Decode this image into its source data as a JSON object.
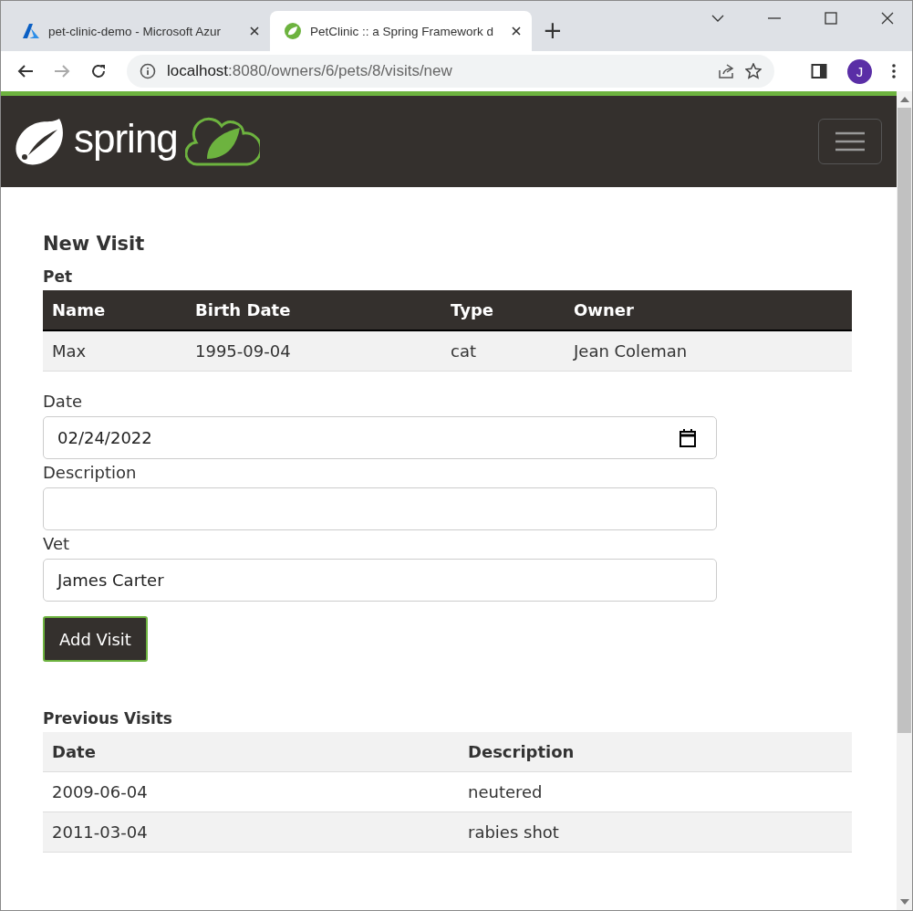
{
  "browser": {
    "tabs": [
      {
        "title": "pet-clinic-demo - Microsoft Azur",
        "selected": false,
        "kind": "azure"
      },
      {
        "title": "PetClinic :: a Spring Framework d",
        "selected": true,
        "kind": "spring"
      }
    ],
    "new_tab": "+",
    "url_host": "localhost",
    "url_path": ":8080/owners/6/pets/8/visits/new",
    "profile": "J"
  },
  "navbar": {
    "logo_text": "spring"
  },
  "page": {
    "title": "New Visit",
    "pet_heading": "Pet",
    "pet_table": {
      "columns": [
        "Name",
        "Birth Date",
        "Type",
        "Owner"
      ],
      "rows": [
        [
          "Max",
          "1995-09-04",
          "cat",
          "Jean Coleman"
        ]
      ]
    },
    "form": {
      "date_label": "Date",
      "date_value": "02/24/2022",
      "description_label": "Description",
      "vet_label": "Vet",
      "vet_value": "James Carter",
      "submit": "Add Visit"
    },
    "previous_heading": "Previous Visits",
    "visits_table": {
      "columns": [
        "Date",
        "Description"
      ],
      "rows": [
        [
          "2009-06-04",
          "neutered"
        ],
        [
          "2011-03-04",
          "rabies shot"
        ]
      ]
    }
  }
}
